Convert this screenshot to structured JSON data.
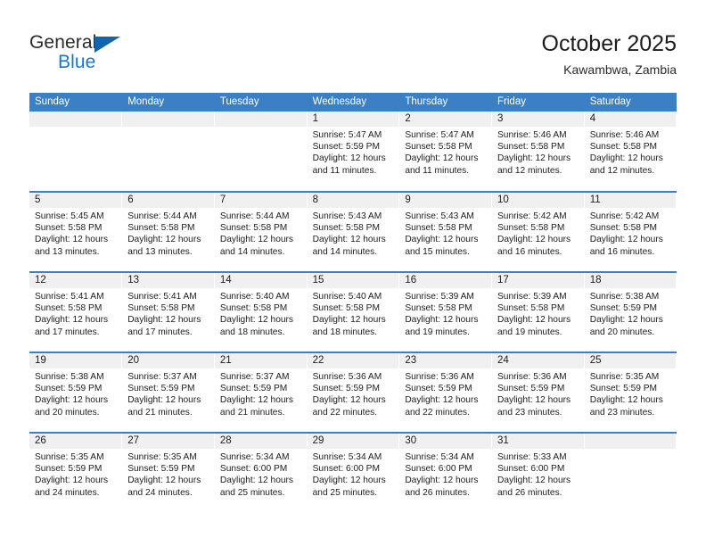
{
  "logo": {
    "word_one": "General",
    "word_two": "Blue",
    "triangle_color": "#1464aa",
    "blue_color": "#1a76c8"
  },
  "header": {
    "title": "October 2025",
    "subtitle": "Kawambwa, Zambia"
  },
  "theme": {
    "header_blue": "#3b7fc4",
    "band_gray": "#f0f0f0",
    "text": "#1c1c1c"
  },
  "calendar": {
    "weekday_headers": [
      "Sunday",
      "Monday",
      "Tuesday",
      "Wednesday",
      "Thursday",
      "Friday",
      "Saturday"
    ],
    "weeks": [
      [
        {
          "day": "",
          "lines": []
        },
        {
          "day": "",
          "lines": []
        },
        {
          "day": "",
          "lines": []
        },
        {
          "day": "1",
          "lines": [
            "Sunrise: 5:47 AM",
            "Sunset: 5:59 PM",
            "Daylight: 12 hours",
            "and 11 minutes."
          ]
        },
        {
          "day": "2",
          "lines": [
            "Sunrise: 5:47 AM",
            "Sunset: 5:58 PM",
            "Daylight: 12 hours",
            "and 11 minutes."
          ]
        },
        {
          "day": "3",
          "lines": [
            "Sunrise: 5:46 AM",
            "Sunset: 5:58 PM",
            "Daylight: 12 hours",
            "and 12 minutes."
          ]
        },
        {
          "day": "4",
          "lines": [
            "Sunrise: 5:46 AM",
            "Sunset: 5:58 PM",
            "Daylight: 12 hours",
            "and 12 minutes."
          ]
        }
      ],
      [
        {
          "day": "5",
          "lines": [
            "Sunrise: 5:45 AM",
            "Sunset: 5:58 PM",
            "Daylight: 12 hours",
            "and 13 minutes."
          ]
        },
        {
          "day": "6",
          "lines": [
            "Sunrise: 5:44 AM",
            "Sunset: 5:58 PM",
            "Daylight: 12 hours",
            "and 13 minutes."
          ]
        },
        {
          "day": "7",
          "lines": [
            "Sunrise: 5:44 AM",
            "Sunset: 5:58 PM",
            "Daylight: 12 hours",
            "and 14 minutes."
          ]
        },
        {
          "day": "8",
          "lines": [
            "Sunrise: 5:43 AM",
            "Sunset: 5:58 PM",
            "Daylight: 12 hours",
            "and 14 minutes."
          ]
        },
        {
          "day": "9",
          "lines": [
            "Sunrise: 5:43 AM",
            "Sunset: 5:58 PM",
            "Daylight: 12 hours",
            "and 15 minutes."
          ]
        },
        {
          "day": "10",
          "lines": [
            "Sunrise: 5:42 AM",
            "Sunset: 5:58 PM",
            "Daylight: 12 hours",
            "and 16 minutes."
          ]
        },
        {
          "day": "11",
          "lines": [
            "Sunrise: 5:42 AM",
            "Sunset: 5:58 PM",
            "Daylight: 12 hours",
            "and 16 minutes."
          ]
        }
      ],
      [
        {
          "day": "12",
          "lines": [
            "Sunrise: 5:41 AM",
            "Sunset: 5:58 PM",
            "Daylight: 12 hours",
            "and 17 minutes."
          ]
        },
        {
          "day": "13",
          "lines": [
            "Sunrise: 5:41 AM",
            "Sunset: 5:58 PM",
            "Daylight: 12 hours",
            "and 17 minutes."
          ]
        },
        {
          "day": "14",
          "lines": [
            "Sunrise: 5:40 AM",
            "Sunset: 5:58 PM",
            "Daylight: 12 hours",
            "and 18 minutes."
          ]
        },
        {
          "day": "15",
          "lines": [
            "Sunrise: 5:40 AM",
            "Sunset: 5:58 PM",
            "Daylight: 12 hours",
            "and 18 minutes."
          ]
        },
        {
          "day": "16",
          "lines": [
            "Sunrise: 5:39 AM",
            "Sunset: 5:58 PM",
            "Daylight: 12 hours",
            "and 19 minutes."
          ]
        },
        {
          "day": "17",
          "lines": [
            "Sunrise: 5:39 AM",
            "Sunset: 5:58 PM",
            "Daylight: 12 hours",
            "and 19 minutes."
          ]
        },
        {
          "day": "18",
          "lines": [
            "Sunrise: 5:38 AM",
            "Sunset: 5:59 PM",
            "Daylight: 12 hours",
            "and 20 minutes."
          ]
        }
      ],
      [
        {
          "day": "19",
          "lines": [
            "Sunrise: 5:38 AM",
            "Sunset: 5:59 PM",
            "Daylight: 12 hours",
            "and 20 minutes."
          ]
        },
        {
          "day": "20",
          "lines": [
            "Sunrise: 5:37 AM",
            "Sunset: 5:59 PM",
            "Daylight: 12 hours",
            "and 21 minutes."
          ]
        },
        {
          "day": "21",
          "lines": [
            "Sunrise: 5:37 AM",
            "Sunset: 5:59 PM",
            "Daylight: 12 hours",
            "and 21 minutes."
          ]
        },
        {
          "day": "22",
          "lines": [
            "Sunrise: 5:36 AM",
            "Sunset: 5:59 PM",
            "Daylight: 12 hours",
            "and 22 minutes."
          ]
        },
        {
          "day": "23",
          "lines": [
            "Sunrise: 5:36 AM",
            "Sunset: 5:59 PM",
            "Daylight: 12 hours",
            "and 22 minutes."
          ]
        },
        {
          "day": "24",
          "lines": [
            "Sunrise: 5:36 AM",
            "Sunset: 5:59 PM",
            "Daylight: 12 hours",
            "and 23 minutes."
          ]
        },
        {
          "day": "25",
          "lines": [
            "Sunrise: 5:35 AM",
            "Sunset: 5:59 PM",
            "Daylight: 12 hours",
            "and 23 minutes."
          ]
        }
      ],
      [
        {
          "day": "26",
          "lines": [
            "Sunrise: 5:35 AM",
            "Sunset: 5:59 PM",
            "Daylight: 12 hours",
            "and 24 minutes."
          ]
        },
        {
          "day": "27",
          "lines": [
            "Sunrise: 5:35 AM",
            "Sunset: 5:59 PM",
            "Daylight: 12 hours",
            "and 24 minutes."
          ]
        },
        {
          "day": "28",
          "lines": [
            "Sunrise: 5:34 AM",
            "Sunset: 6:00 PM",
            "Daylight: 12 hours",
            "and 25 minutes."
          ]
        },
        {
          "day": "29",
          "lines": [
            "Sunrise: 5:34 AM",
            "Sunset: 6:00 PM",
            "Daylight: 12 hours",
            "and 25 minutes."
          ]
        },
        {
          "day": "30",
          "lines": [
            "Sunrise: 5:34 AM",
            "Sunset: 6:00 PM",
            "Daylight: 12 hours",
            "and 26 minutes."
          ]
        },
        {
          "day": "31",
          "lines": [
            "Sunrise: 5:33 AM",
            "Sunset: 6:00 PM",
            "Daylight: 12 hours",
            "and 26 minutes."
          ]
        },
        {
          "day": "",
          "lines": []
        }
      ]
    ]
  }
}
